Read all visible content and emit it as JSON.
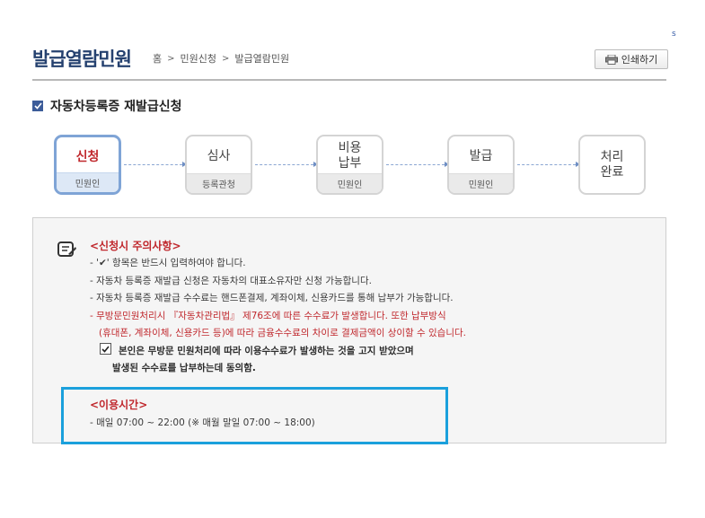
{
  "corner_mark": "s",
  "header": {
    "title": "발급열람민원",
    "breadcrumb": [
      "홈",
      "민원신청",
      "발급열람민원"
    ],
    "print_label": "인쇄하기"
  },
  "section": {
    "title": "자동차등록증 재발급신청"
  },
  "steps": [
    {
      "label": "신청",
      "who": "민원인",
      "active": true
    },
    {
      "label": "심사",
      "who": "등록관청",
      "active": false
    },
    {
      "label": "비용\n납부",
      "who": "민원인",
      "active": false
    },
    {
      "label": "발급",
      "who": "민원인",
      "active": false
    },
    {
      "label": "처리\n완료",
      "who": "",
      "active": false
    }
  ],
  "notice": {
    "caution_title": "<신청시 주의사항>",
    "lines": [
      "- '✔' 항목은 반드시 입력하여야 합니다.",
      "- 자동차 등록증 재발급 신청은 자동차의 대표소유자만 신청 가능합니다.",
      "- 자동차 등록증 재발급 수수료는 핸드폰결제, 계좌이체, 신용카드를 통해 납부가 가능합니다."
    ],
    "red_line_1": "- 무방문민원처리시 『자동차관리법』 제76조에 따른 수수료가 발생합니다. 또한 납부방식",
    "red_line_2": "(휴대폰, 계좌이체, 신용카드 등)에 따라 금융수수료의 차이로 결제금액이 상이할 수 있습니다.",
    "agree_line_1": "본인은 무방문 민원처리에 따라 이용수수료가 발생하는 것을 고지 받았으며",
    "agree_line_2": "발생된 수수료를 납부하는데 동의함.",
    "hours_title": "<이용시간>",
    "hours_text": "- 매일 07:00 ~ 22:00 (※ 매월 말일 07:00 ~ 18:00)"
  },
  "colors": {
    "title_blue": "#25416f",
    "accent_red": "#c0282d",
    "highlight_blue": "#1aa0dc"
  }
}
